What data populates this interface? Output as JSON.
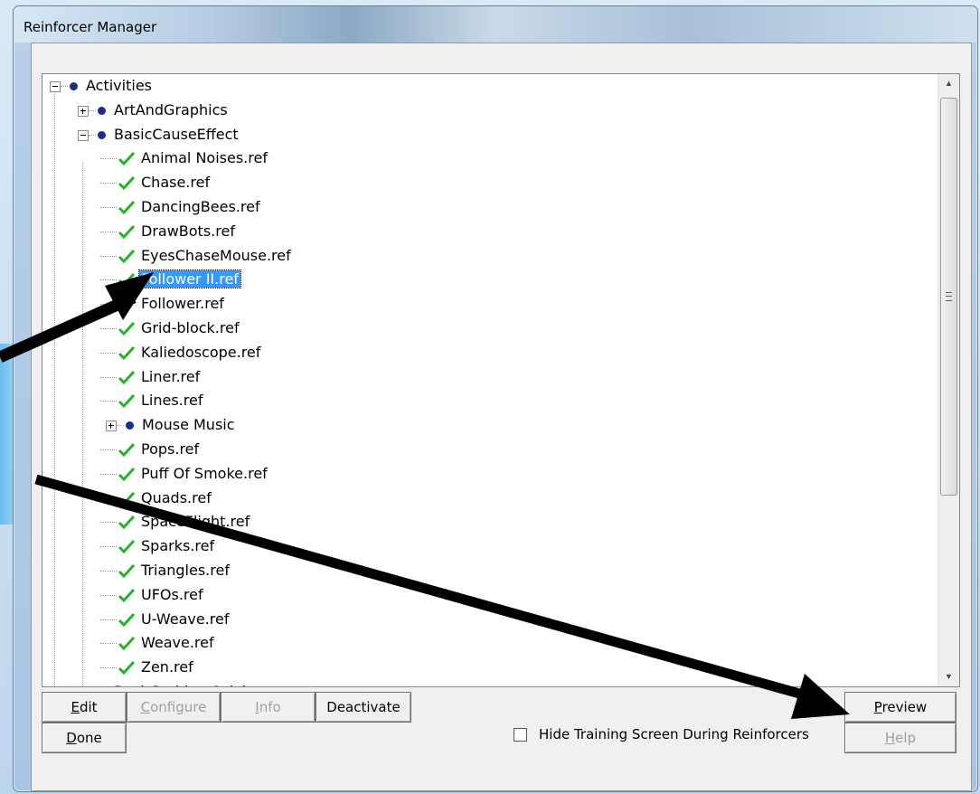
{
  "window": {
    "title": "Reinforcer Manager"
  },
  "tree": {
    "root_label": "Activities",
    "folders": {
      "art": "ArtAndGraphics",
      "basic": "BasicCauseEffect",
      "mouse_music": "Mouse Music",
      "basic_problem": "BasicProblemSolving"
    },
    "items": [
      "Animal Noises.ref",
      "Chase.ref",
      "DancingBees.ref",
      "DrawBots.ref",
      "EyesChaseMouse.ref",
      "Follower II.ref",
      "Follower.ref",
      "Grid-block.ref",
      "Kaliedoscope.ref",
      "Liner.ref",
      "Lines.ref",
      "Pops.ref",
      "Puff Of Smoke.ref",
      "Quads.ref",
      "SpaceFlight.ref",
      "Sparks.ref",
      "Triangles.ref",
      "UFOs.ref",
      "U-Weave.ref",
      "Weave.ref",
      "Zen.ref"
    ],
    "selected": "Follower II.ref"
  },
  "buttons": {
    "edit": "Edit",
    "configure": "Configure",
    "info": "Info",
    "deactivate": "Deactivate",
    "preview": "Preview",
    "done": "Done",
    "help": "Help"
  },
  "hide_training_label": "Hide Training Screen During Reinforcers",
  "hide_training_checked": false,
  "colors": {
    "selection": "#3399ff",
    "check": "#22b422",
    "dot": "#1c2c8c",
    "arrow": "#000000"
  },
  "icons": {
    "check": "green-check-icon",
    "dot": "blue-dot-icon"
  }
}
